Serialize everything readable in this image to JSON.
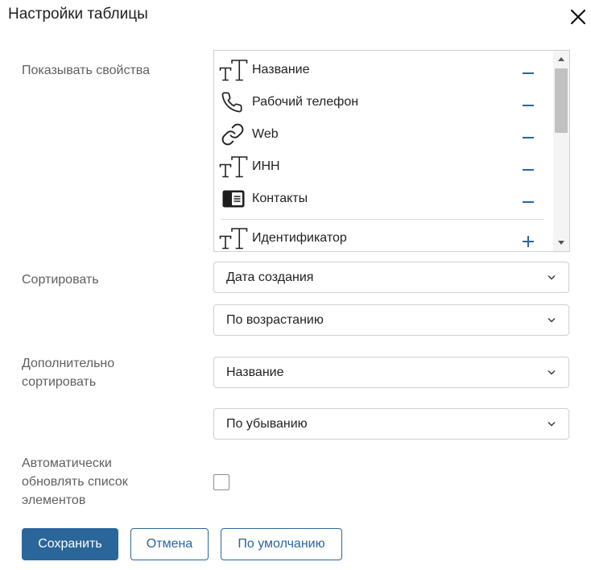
{
  "dialog": {
    "title": "Настройки таблицы",
    "close_icon": "close-icon"
  },
  "properties": {
    "label": "Показывать свойства",
    "shown": [
      {
        "label": "Название",
        "icon": "text-type-icon",
        "action_icon": "minus-icon"
      },
      {
        "label": "Рабочий телефон",
        "icon": "phone-icon",
        "action_icon": "minus-icon"
      },
      {
        "label": "Web",
        "icon": "link-icon",
        "action_icon": "minus-icon"
      },
      {
        "label": "ИНН",
        "icon": "text-type-icon",
        "action_icon": "minus-icon"
      },
      {
        "label": "Контакты",
        "icon": "contact-card-icon",
        "action_icon": "minus-icon"
      }
    ],
    "hidden": [
      {
        "label": "Идентификатор",
        "icon": "text-type-icon",
        "action_icon": "plus-icon"
      }
    ]
  },
  "sort": {
    "label": "Сортировать",
    "field": "Дата создания",
    "direction": "По возрастанию"
  },
  "extra_sort": {
    "label_lines": [
      "Дополнительно",
      "сортировать"
    ],
    "field": "Название",
    "direction": "По убыванию"
  },
  "auto_refresh": {
    "label_lines": [
      "Автоматически",
      "обновлять список",
      "элементов"
    ],
    "checked": false
  },
  "buttons": {
    "save": "Сохранить",
    "cancel": "Отмена",
    "default": "По умолчанию"
  },
  "colors": {
    "accent": "#2b669a",
    "label": "#5f5f5f",
    "text": "#222222",
    "border": "#cfcfcf",
    "scroll_thumb": "#c1c1c1"
  }
}
